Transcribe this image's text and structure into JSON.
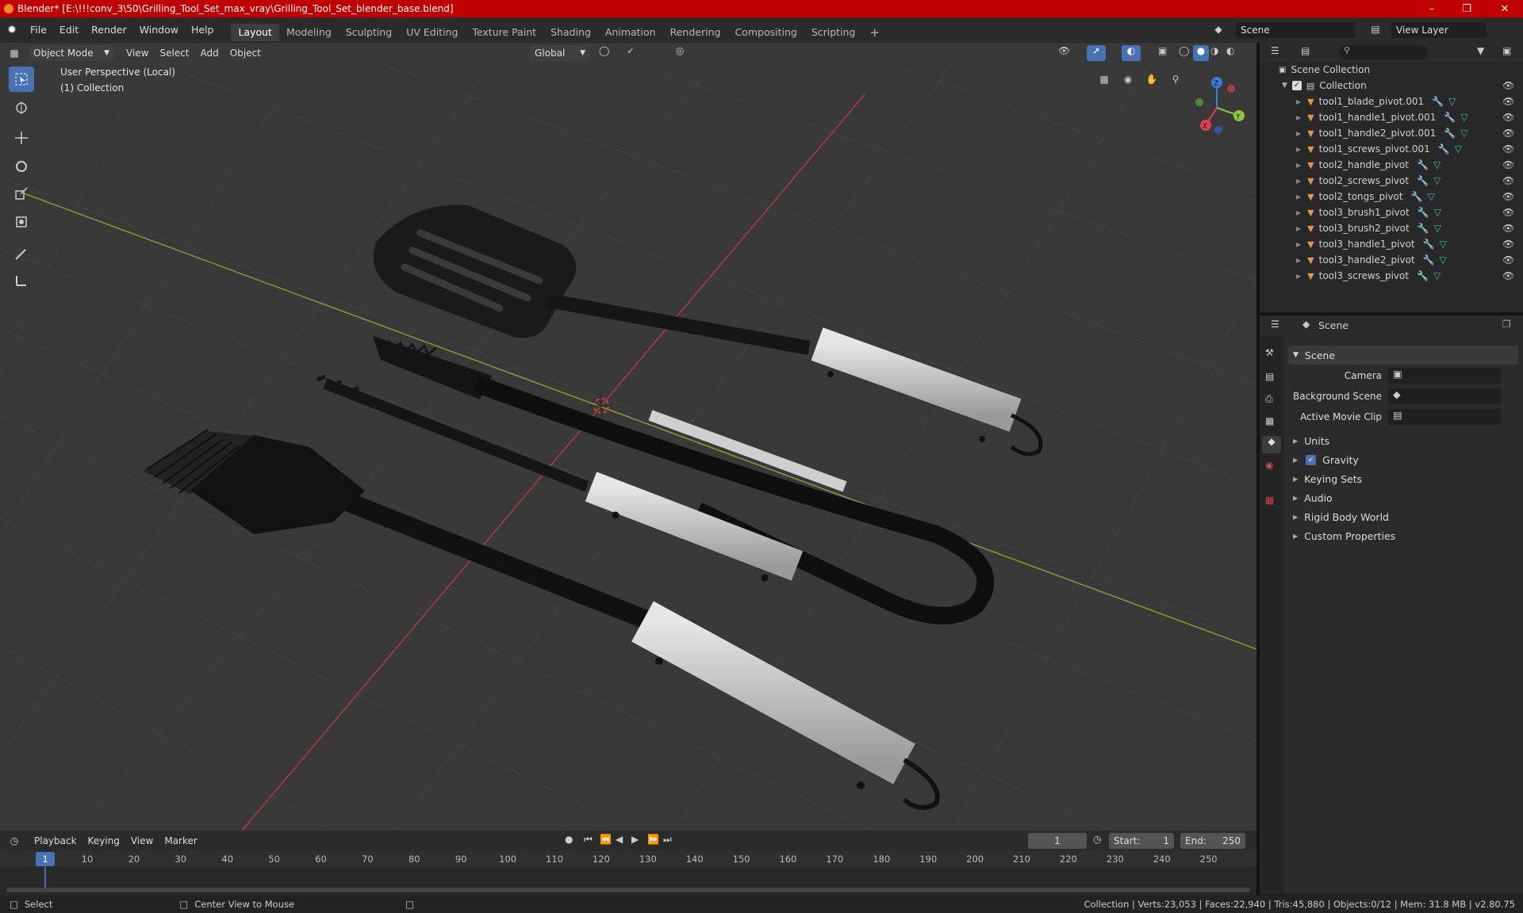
{
  "window": {
    "title": "Blender* [E:\\!!!conv_3\\50\\Grilling_Tool_Set_max_vray\\Grilling_Tool_Set_blender_base.blend]"
  },
  "menu": [
    "File",
    "Edit",
    "Render",
    "Window",
    "Help"
  ],
  "workspaces": [
    "Layout",
    "Modeling",
    "Sculpting",
    "UV Editing",
    "Texture Paint",
    "Shading",
    "Animation",
    "Rendering",
    "Compositing",
    "Scripting"
  ],
  "active_workspace": "Layout",
  "scene_field": "Scene",
  "view_layer_field": "View Layer",
  "viewport": {
    "mode": "Object Mode",
    "menus": [
      "View",
      "Select",
      "Add",
      "Object"
    ],
    "transform_orientation": "Global",
    "overlay_line1": "User Perspective (Local)",
    "overlay_line2": "(1) Collection",
    "gizmo": {
      "x": "X",
      "y": "Y",
      "z": "Z"
    }
  },
  "outliner": {
    "root": "Scene Collection",
    "collection": "Collection",
    "items": [
      "tool1_blade_pivot.001",
      "tool1_handle1_pivot.001",
      "tool1_handle2_pivot.001",
      "tool1_screws_pivot.001",
      "tool2_handle_pivot",
      "tool2_screws_pivot",
      "tool2_tongs_pivot",
      "tool3_brush1_pivot",
      "tool3_brush2_pivot",
      "tool3_handle1_pivot",
      "tool3_handle2_pivot",
      "tool3_screws_pivot"
    ]
  },
  "properties": {
    "header": "Scene",
    "panel": "Scene",
    "fields": [
      "Camera",
      "Background Scene",
      "Active Movie Clip"
    ],
    "sections": [
      "Units",
      "Gravity",
      "Keying Sets",
      "Audio",
      "Rigid Body World",
      "Custom Properties"
    ],
    "gravity_checked": true
  },
  "timeline": {
    "menus": [
      "Playback",
      "Keying",
      "View",
      "Marker"
    ],
    "current_frame": "1",
    "start_label": "Start:",
    "start": "1",
    "end_label": "End:",
    "end": "250",
    "ruler": [
      "1",
      "10",
      "20",
      "30",
      "40",
      "50",
      "60",
      "70",
      "80",
      "90",
      "100",
      "110",
      "120",
      "130",
      "140",
      "150",
      "160",
      "170",
      "180",
      "190",
      "200",
      "210",
      "220",
      "230",
      "240",
      "250"
    ]
  },
  "statusbar": {
    "left": "Select",
    "middle": "Center View to Mouse",
    "right": "Collection | Verts:23,053 | Faces:22,940 | Tris:45,880 | Objects:0/12 | Mem: 31.8 MB | v2.80.75"
  },
  "colors": {
    "accent": "#4772b3",
    "titlebar": "#c00000",
    "object_icon": "#e8953a",
    "modifier_icon": "#4ea3e6",
    "mesh_icon": "#34c6a4"
  }
}
